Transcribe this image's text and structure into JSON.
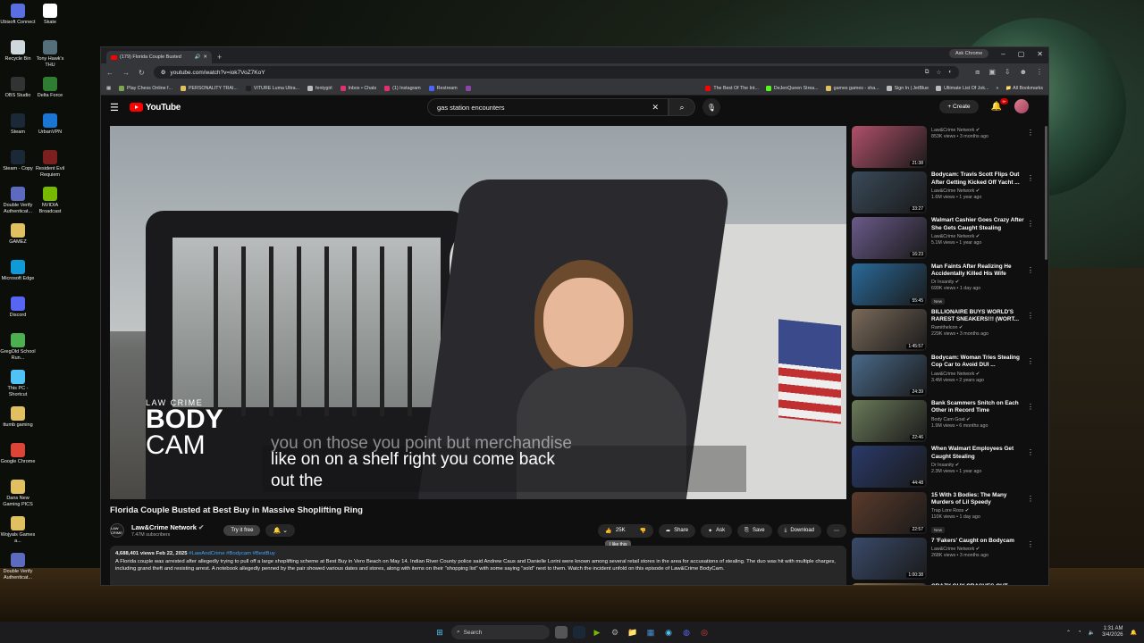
{
  "desktop": {
    "icons": [
      {
        "label": "Ubisoft Connect",
        "color": "#5b6ee1"
      },
      {
        "label": "Skate",
        "color": "#ffffff"
      },
      {
        "label": "Recycle Bin",
        "color": "#cfd8dc"
      },
      {
        "label": "Tony Hawk's THU",
        "color": "#546e7a"
      },
      {
        "label": "OBS Studio",
        "color": "#333333"
      },
      {
        "label": "Delta Force",
        "color": "#2e7d32"
      },
      {
        "label": "Steam",
        "color": "#1b2838"
      },
      {
        "label": "UrbanVPN",
        "color": "#1976d2"
      },
      {
        "label": "Steam - Copy",
        "color": "#1b2838"
      },
      {
        "label": "Resident Evil Requiem",
        "color": "#7b1f1f"
      },
      {
        "label": "Double Verify Authenticat...",
        "color": "#5c6bc0"
      },
      {
        "label": "NVIDIA Broadcast",
        "color": "#76b900"
      },
      {
        "label": "GAMEZ",
        "color": "#e0c060"
      },
      {
        "label": "Microsoft Edge",
        "color": "#0f9bd7"
      },
      {
        "label": "Discord",
        "color": "#5865f2"
      },
      {
        "label": "GregOld School Run...",
        "color": "#4caf50"
      },
      {
        "label": "This PC - Shortcut",
        "color": "#4fc3f7"
      },
      {
        "label": "ttumb gaming",
        "color": "#e0c060"
      },
      {
        "label": "Google Chrome",
        "color": "#db4437"
      },
      {
        "label": "Dans New Gaming PICS",
        "color": "#e0c060"
      },
      {
        "label": "Wojyals Games a...",
        "color": "#e0c060"
      },
      {
        "label": "Double Verify Authenticat...",
        "color": "#5c6bc0"
      }
    ]
  },
  "taskbar": {
    "search_placeholder": "Search",
    "time": "1:31 AM",
    "date": "3/4/2026"
  },
  "browser": {
    "tab_title": "(179) Florida Couple Busted",
    "ask_chrome": "Ask Chrome",
    "url": "youtube.com/watch?v=iok7VoZ7KoY",
    "bookmarks": [
      {
        "label": "Play Chess Online f...",
        "color": "#7fa650"
      },
      {
        "label": "PERSONALITY TRAI...",
        "color": "#e0c060"
      },
      {
        "label": "VITURE Luma Ultra...",
        "color": "#222222"
      },
      {
        "label": "fentygirl",
        "color": "#bbbbbb"
      },
      {
        "label": "Inbox • Chats",
        "color": "#e1306c"
      },
      {
        "label": "(1) Instagram",
        "color": "#e1306c"
      },
      {
        "label": "Restream",
        "color": "#4a66f5"
      },
      {
        "label": "",
        "color": "#8e44ad"
      }
    ],
    "bookmarks_right": [
      {
        "label": "The Best Of The Int...",
        "color": "#ff0000"
      },
      {
        "label": "DeJenQueen Strea...",
        "color": "#53fc18"
      },
      {
        "label": "games games - sha...",
        "color": "#e0c060"
      },
      {
        "label": "Sign In | JetBlue",
        "color": "#bbbbbb"
      },
      {
        "label": "Ultimate List Of Jok...",
        "color": "#bbbbbb"
      }
    ],
    "all_bookmarks": "All Bookmarks"
  },
  "youtube": {
    "logo_text": "YouTube",
    "search_value": "gas station encounters",
    "create_label": "Create",
    "notif_count": "9+",
    "player": {
      "overlay_top": "LAW CRIME",
      "overlay_body": "BODY",
      "overlay_cam": "CAM",
      "subtitle_ghost": "you on those you point but merchandise",
      "subtitle_line1": "like on on a shelf right you come back",
      "subtitle_line2": "out the"
    },
    "video_title": "Florida Couple Busted at Best Buy in Massive Shoplifting Ring",
    "channel": {
      "avatar_text": "LAW CRIME",
      "name": "Law&Crime Network",
      "subs": "7.47M subscribers",
      "try_free": "Try it free"
    },
    "actions": {
      "likes": "25K",
      "like_tooltip": "I like this",
      "share": "Share",
      "ask": "Ask",
      "save": "Save",
      "download": "Download"
    },
    "description": {
      "meta": "4,688,401 views  Feb 22, 2025",
      "tags": "#LawAndCrime #Bodycam #BestBuy",
      "text": "A Florida couple was arrested after allegedly trying to pull off a large shoplifting scheme at Best Buy in Vero Beach on May 14. Indian River County police said Andrew Caus and Danielle Lorini were known among several retail stores in the area for accusations of stealing. The duo was hit with multiple charges, including grand theft and resisting arrest. A notebook allegedly penned by the pair showed various dates and stores, along with items on their \"shopping list\" with some saying \"sold\" next to them. Watch the incident unfold on this episode of Law&Crime BodyCam."
    },
    "recommendations": [
      {
        "title": "",
        "channel": "Law&Crime Network",
        "meta": "853K views • 3 months ago",
        "duration": "21:38",
        "color": "#b0506a",
        "new": ""
      },
      {
        "title": "Bodycam: Travis Scott Flips Out After Getting Kicked Off Yacht ...",
        "channel": "Law&Crime Network",
        "meta": "1.6M views • 1 year ago",
        "duration": "33:27",
        "color": "#3a4a5a",
        "new": ""
      },
      {
        "title": "Walmart Cashier Goes Crazy After She Gets Caught Stealing",
        "channel": "Law&Crime Network",
        "meta": "5.1M views • 1 year ago",
        "duration": "16:23",
        "color": "#6a5a8a",
        "new": ""
      },
      {
        "title": "Man Faints After Realizing He Accidentally Killed His Wife",
        "channel": "Dr Insanity",
        "meta": "699K views • 1 day ago",
        "duration": "55:45",
        "color": "#2a6a9a",
        "new": "New"
      },
      {
        "title": "BILLIONAIRE BUYS WORLD'S RAREST SNEAKERS!!! (WORT...",
        "channel": "Ramithelcon",
        "meta": "229K views • 3 months ago",
        "duration": "1:45:57",
        "color": "#7a6a5a",
        "new": ""
      },
      {
        "title": "Bodycam: Woman Tries Stealing Cop Car to Avoid DUI ...",
        "channel": "Law&Crime Network",
        "meta": "3.4M views • 2 years ago",
        "duration": "24:39",
        "color": "#4a6a8a",
        "new": ""
      },
      {
        "title": "Bank Scammers Snitch on Each Other in Record Time",
        "channel": "Body Cam Goat",
        "meta": "1.9M views • 6 months ago",
        "duration": "22:46",
        "color": "#6a7a5a",
        "new": ""
      },
      {
        "title": "When Walmart Employees Get Caught Stealing",
        "channel": "Dr Insanity",
        "meta": "2.3M views • 1 year ago",
        "duration": "44:48",
        "color": "#2a3a6a",
        "new": ""
      },
      {
        "title": "15 With 3 Bodies: The Many Murders of Lil Speedy",
        "channel": "Trap Lore Ross",
        "meta": "110K views • 1 day ago",
        "duration": "22:57",
        "color": "#5a3a2a",
        "new": "New"
      },
      {
        "title": "7 'Fakers' Caught on Bodycam",
        "channel": "Law&Crime Network",
        "meta": "268K views • 3 months ago",
        "duration": "1:00:38",
        "color": "#3a4a6a",
        "new": ""
      },
      {
        "title": "CRAZY GUY CRASHES OUT...",
        "channel": "",
        "meta": "",
        "duration": "",
        "color": "#8a6a3a",
        "new": ""
      }
    ]
  }
}
